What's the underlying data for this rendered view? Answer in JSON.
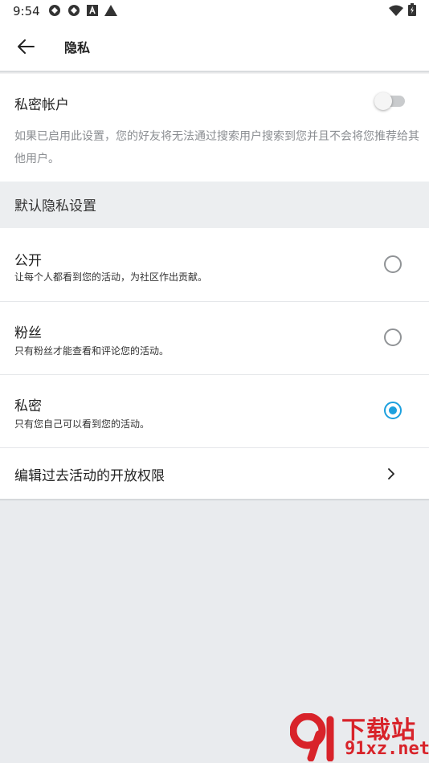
{
  "status_bar": {
    "time": "9:54"
  },
  "app_bar": {
    "title": "隐私"
  },
  "private_account": {
    "label": "私密帐户",
    "enabled": false,
    "description": "如果已启用此设置，您的好友将无法通过搜索用户搜索到您并且不会将您推荐给其他用户。"
  },
  "default_privacy": {
    "header": "默认隐私设置",
    "options": [
      {
        "label": "公开",
        "description": "让每个人都看到您的活动，为社区作出贡献。",
        "selected": false
      },
      {
        "label": "粉丝",
        "description": "只有粉丝才能查看和评论您的活动。",
        "selected": false
      },
      {
        "label": "私密",
        "description": "只有您自己可以看到您的活动。",
        "selected": true
      }
    ]
  },
  "edit_past": {
    "label": "编辑过去活动的开放权限"
  },
  "watermark": {
    "brand": "下载站",
    "domain": "91xz.net"
  },
  "colors": {
    "accent": "#1ca0de",
    "background": "#e9ebee",
    "watermark": "#d8232a"
  }
}
